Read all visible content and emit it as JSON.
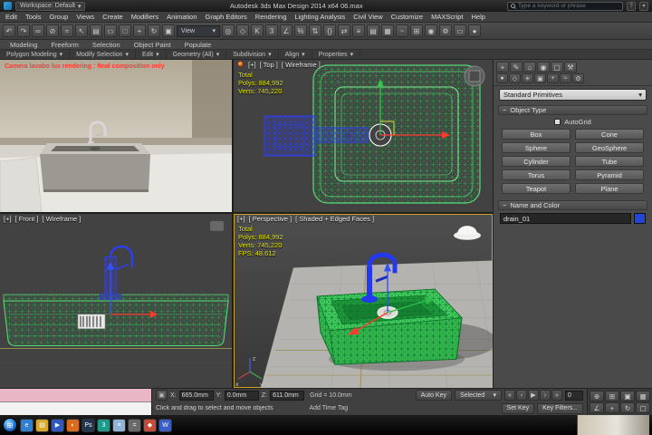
{
  "ui": {
    "caret": "▾",
    "collapse": "−"
  },
  "titlebar": {
    "workspace_label": "Workspace: Default",
    "title": "Autodesk 3ds Max Design 2014 x64   06.max",
    "search_placeholder": "Type a keyword or phrase"
  },
  "menubar": {
    "items": [
      "Edit",
      "Tools",
      "Group",
      "Views",
      "Create",
      "Modifiers",
      "Animation",
      "Graph Editors",
      "Rendering",
      "Lighting Analysis",
      "Civil View",
      "Customize",
      "MAXScript",
      "Help"
    ]
  },
  "toolbar": {
    "reference_coord_label": "View",
    "icons_a": [
      {
        "name": "undo-icon",
        "glyph": "↶"
      },
      {
        "name": "redo-icon",
        "glyph": "↷"
      },
      {
        "name": "select-and-link-icon",
        "glyph": "∞"
      },
      {
        "name": "unlink-selection-icon",
        "glyph": "⊘"
      },
      {
        "name": "bind-to-space-warp-icon",
        "glyph": "≈"
      },
      {
        "name": "select-object-icon",
        "glyph": "↖"
      },
      {
        "name": "select-by-name-icon",
        "glyph": "▤"
      },
      {
        "name": "rectangular-selection-region-icon",
        "glyph": "▭"
      },
      {
        "name": "window-crossing-icon",
        "glyph": "□"
      },
      {
        "name": "select-and-move-icon",
        "glyph": "+"
      },
      {
        "name": "select-and-rotate-icon",
        "glyph": "↻"
      },
      {
        "name": "select-and-scale-icon",
        "glyph": "▣"
      }
    ],
    "icons_b": [
      {
        "name": "use-pivot-center-icon",
        "glyph": "◎"
      },
      {
        "name": "select-and-manipulate-icon",
        "glyph": "◇"
      },
      {
        "name": "keyboard-override-icon",
        "glyph": "K"
      },
      {
        "name": "snap-toggle-3d-icon",
        "glyph": "3"
      },
      {
        "name": "angle-snap-icon",
        "glyph": "∠"
      },
      {
        "name": "percent-snap-icon",
        "glyph": "%"
      },
      {
        "name": "spinner-snap-icon",
        "glyph": "⇅"
      },
      {
        "name": "named-selection-sets-icon",
        "glyph": "{}"
      },
      {
        "name": "mirror-icon",
        "glyph": "⇄"
      },
      {
        "name": "align-icon",
        "glyph": "≡"
      },
      {
        "name": "layer-manager-icon",
        "glyph": "▤"
      },
      {
        "name": "graphite-ribbon-icon",
        "glyph": "▦"
      },
      {
        "name": "curve-editor-icon",
        "glyph": "~"
      },
      {
        "name": "schematic-view-icon",
        "glyph": "⊞"
      },
      {
        "name": "material-editor-icon",
        "glyph": "◉"
      },
      {
        "name": "render-setup-icon",
        "glyph": "⚙"
      },
      {
        "name": "rendered-frame-icon",
        "glyph": "▭"
      },
      {
        "name": "render-production-icon",
        "glyph": "●"
      }
    ]
  },
  "ribbon": {
    "tabs": [
      "Modeling",
      "Freeform",
      "Selection",
      "Object Paint",
      "Populate"
    ],
    "sections": [
      "Polygon Modeling",
      "Modify Selection",
      "Edit",
      "Geometry (All)",
      "Subdivision",
      "Align",
      "Properties"
    ]
  },
  "viewports": {
    "camera": {
      "label": "Camera lavabo lux rendering : final composition only"
    },
    "top": {
      "menu_plus": "[+]",
      "menu_view": "[ Top ]",
      "menu_shading": "[ Wireframe ]",
      "stats": {
        "total": "Total",
        "polys": "Polys: 884,992",
        "verts": "Verts: 745,220"
      }
    },
    "front": {
      "menu_plus": "[+]",
      "menu_view": "[ Front ]",
      "menu_shading": "[ Wireframe ]"
    },
    "perspective": {
      "menu_plus": "[+]",
      "menu_view": "[ Perspective ]",
      "menu_shading": "[ Shaded + Edged Faces ]",
      "stats": {
        "total": "Total",
        "polys": "Polys: 884,992",
        "verts": "Verts: 745,220",
        "fps": "FPS: 48.612"
      },
      "axis": {
        "x": "x",
        "y": "y",
        "z": "z"
      }
    }
  },
  "command_panel": {
    "tabs": [
      {
        "name": "create-tab-icon",
        "glyph": "+"
      },
      {
        "name": "modify-tab-icon",
        "glyph": "✎"
      },
      {
        "name": "hierarchy-tab-icon",
        "glyph": "⌂"
      },
      {
        "name": "motion-tab-icon",
        "glyph": "◉"
      },
      {
        "name": "display-tab-icon",
        "glyph": "▢"
      },
      {
        "name": "utilities-tab-icon",
        "glyph": "⚒"
      }
    ],
    "subtabs": [
      {
        "name": "geometry-category-icon",
        "glyph": "●"
      },
      {
        "name": "shapes-category-icon",
        "glyph": "◇"
      },
      {
        "name": "lights-category-icon",
        "glyph": "☀"
      },
      {
        "name": "cameras-category-icon",
        "glyph": "▣"
      },
      {
        "name": "helpers-category-icon",
        "glyph": "+"
      },
      {
        "name": "space-warps-category-icon",
        "glyph": "≈"
      },
      {
        "name": "systems-category-icon",
        "glyph": "⚙"
      }
    ],
    "category_dropdown": "Standard Primitives",
    "object_type_title": "Object Type",
    "autogrid_label": "AutoGrid",
    "buttons": [
      "Box",
      "Cone",
      "Sphere",
      "GeoSphere",
      "Cylinder",
      "Tube",
      "Torus",
      "Pyramid",
      "Teapot",
      "Plane"
    ],
    "name_color_title": "Name and Color",
    "object_name": "drain_01"
  },
  "statusbar": {
    "lock_glyph": "▣",
    "coords": {
      "x_label": "X:",
      "x": "665.0mm",
      "y_label": "Y:",
      "y": "0.0mm",
      "z_label": "Z:",
      "z": "611.0mm"
    },
    "grid": "Grid = 10.0mm",
    "auto_key": "Auto Key",
    "selected": "Selected",
    "set_key": "Set Key",
    "key_filters": "Key Filters...",
    "transport": [
      {
        "name": "go-to-start-icon",
        "glyph": "«"
      },
      {
        "name": "previous-frame-icon",
        "glyph": "‹"
      },
      {
        "name": "play-icon",
        "glyph": "▶"
      },
      {
        "name": "next-frame-icon",
        "glyph": "›"
      },
      {
        "name": "go-to-end-icon",
        "glyph": "»"
      }
    ],
    "time_value": "0",
    "nav": [
      {
        "name": "zoom-icon",
        "glyph": "⊕"
      },
      {
        "name": "zoom-all-icon",
        "glyph": "⊞"
      },
      {
        "name": "zoom-extents-icon",
        "glyph": "▣"
      },
      {
        "name": "zoom-extents-all-icon",
        "glyph": "▦"
      },
      {
        "name": "field-of-view-icon",
        "glyph": "∠"
      },
      {
        "name": "pan-icon",
        "glyph": "+"
      },
      {
        "name": "orbit-icon",
        "glyph": "↻"
      },
      {
        "name": "maximize-viewport-icon",
        "glyph": "▢"
      }
    ],
    "prompt": "Click and drag to select and move objects",
    "add_time_tag": "Add Time Tag"
  },
  "taskbar": {
    "start_glyph": "⊞",
    "items": [
      {
        "name": "taskbar-internet-explorer-icon",
        "color": "#2f7fd4",
        "glyph": "e"
      },
      {
        "name": "taskbar-explorer-icon",
        "color": "#d9a92f",
        "glyph": "▤"
      },
      {
        "name": "taskbar-media-player-icon",
        "color": "#2f58c4",
        "glyph": "▶"
      },
      {
        "name": "taskbar-firefox-icon",
        "color": "#d96a1f",
        "glyph": "◐"
      },
      {
        "name": "taskbar-photoshop-icon",
        "color": "#20364f",
        "glyph": "Ps"
      },
      {
        "name": "taskbar-3ds-max-icon",
        "color": "#1f9a8a",
        "glyph": "3"
      },
      {
        "name": "taskbar-notepad-icon",
        "color": "#8fb4d9",
        "glyph": "≡"
      },
      {
        "name": "taskbar-calculator-icon",
        "color": "#6a6a6a",
        "glyph": "="
      },
      {
        "name": "taskbar-paint-icon",
        "color": "#c44a3a",
        "glyph": "◆"
      },
      {
        "name": "taskbar-word-icon",
        "color": "#3a5fc4",
        "glyph": "W"
      }
    ]
  }
}
